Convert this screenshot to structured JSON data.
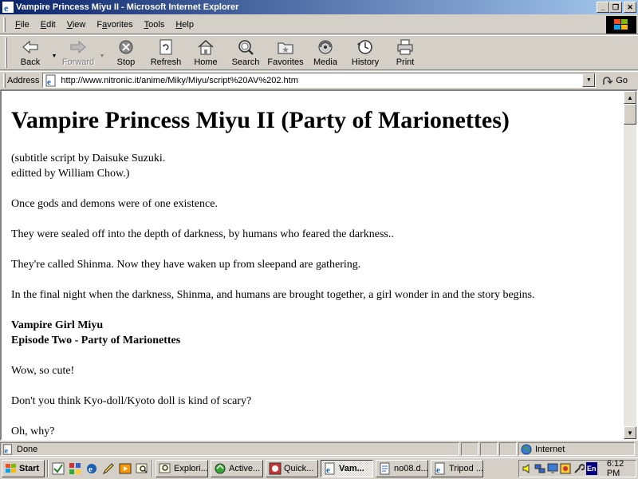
{
  "window": {
    "title": "Vampire Princess Miyu II - Microsoft Internet Explorer",
    "minimize": "_",
    "restore": "❐",
    "close": "✕"
  },
  "menu": {
    "items": [
      {
        "label": "File",
        "key": "F",
        "rest": "ile"
      },
      {
        "label": "Edit",
        "key": "E",
        "rest": "dit"
      },
      {
        "label": "View",
        "key": "V",
        "rest": "iew"
      },
      {
        "label": "Favorites",
        "key": "a",
        "pre": "F",
        "rest": "vorites"
      },
      {
        "label": "Tools",
        "key": "T",
        "rest": "ools"
      },
      {
        "label": "Help",
        "key": "H",
        "rest": "elp"
      }
    ]
  },
  "toolbar": {
    "back": "Back",
    "forward": "Forward",
    "stop": "Stop",
    "refresh": "Refresh",
    "home": "Home",
    "search": "Search",
    "favorites": "Favorites",
    "media": "Media",
    "history": "History",
    "print": "Print"
  },
  "address": {
    "label": "Address",
    "url": "http://www.nitronic.it/anime/Miky/Miyu/script%20AV%202.htm",
    "go": "Go"
  },
  "page": {
    "heading": "Vampire Princess Miyu II (Party of Marionettes)",
    "credit_line1": "(subtitle script by Daisuke Suzuki.",
    "credit_line2": "editted by William Chow.)",
    "p1": "Once gods and demons were of one existence.",
    "p2": "They were sealed off into the depth of darkness, by humans who feared the darkness..",
    "p3": "They're called Shinma. Now they have waken up from sleepand are gathering.",
    "p4": "In the final night when the darkness, Shinma, and humans are brought together, a girl wonder in and the story begins.",
    "bold1": "Vampire Girl Miyu",
    "bold2": "Episode Two - Party of Marionettes",
    "p5": "Wow, so cute!",
    "p6": "Don't you think Kyo-doll/Kyoto doll is kind of scary?",
    "p7": "Oh, why?"
  },
  "status": {
    "text": "Done",
    "zone": "Internet"
  },
  "taskbar": {
    "start": "Start",
    "tasks": [
      {
        "label": "Explori...",
        "active": false
      },
      {
        "label": "Active...",
        "active": false
      },
      {
        "label": "Quick...",
        "active": false
      },
      {
        "label": "Vam...",
        "active": true
      },
      {
        "label": "no08.d...",
        "active": false
      },
      {
        "label": "Tripod ...",
        "active": false
      }
    ],
    "lang": "En",
    "clock": "6:12 PM"
  }
}
